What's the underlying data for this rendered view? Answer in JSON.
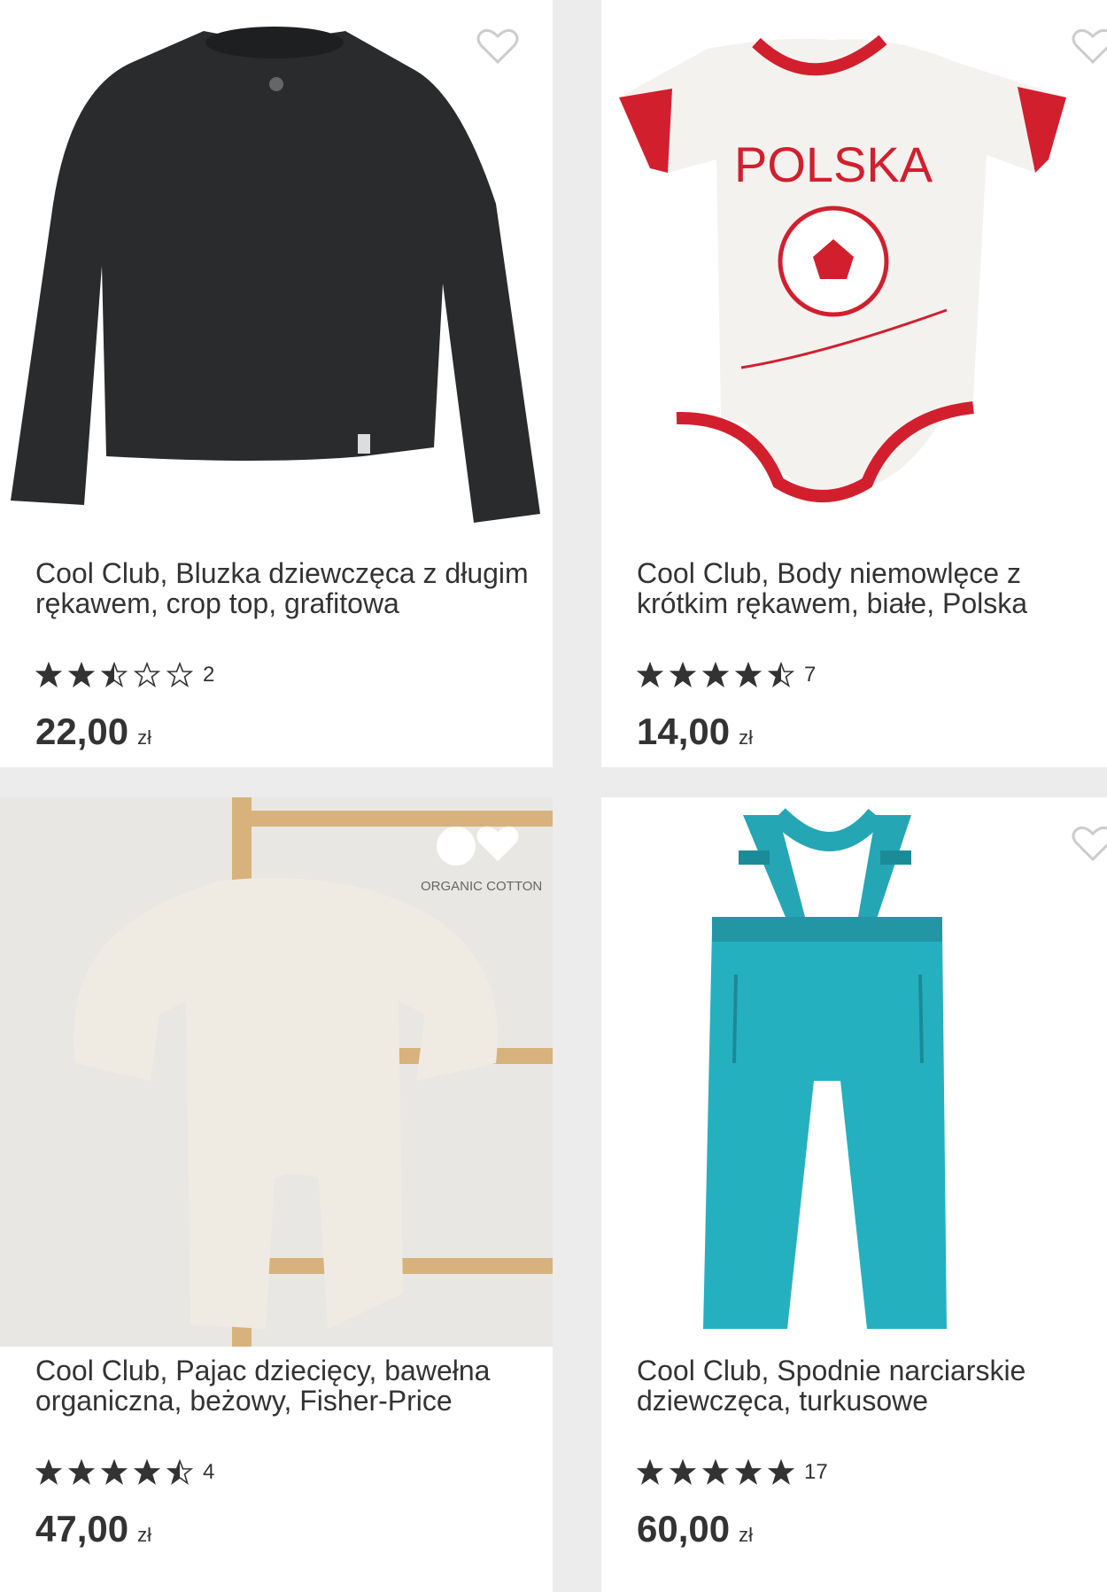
{
  "products": [
    {
      "title": "Cool Club, Bluzka dziewczęca z długim rękawem, crop top, grafitowa",
      "rating": 2.5,
      "review_count": "2",
      "price": "22,00",
      "currency": "zł"
    },
    {
      "title": "Cool Club, Body niemowlęce z krótkim rękawem, białe, Polska",
      "rating": 4.5,
      "review_count": "7",
      "price": "14,00",
      "currency": "zł",
      "image_text": "POLSKA"
    },
    {
      "title": "Cool Club, Pajac dziecięcy, bawełna organiczna, beżowy, Fisher-Price",
      "rating": 4.5,
      "review_count": "4",
      "price": "47,00",
      "currency": "zł",
      "badge": "ORGANIC COTTON"
    },
    {
      "title": "Cool Club, Spodnie narciarskie dziewczęca, turkusowe",
      "rating": 5,
      "review_count": "17",
      "price": "60,00",
      "currency": "zł"
    }
  ],
  "colors": {
    "text": "#333333",
    "star": "#333333",
    "heart": "#cccccc"
  },
  "icons": [
    "heart-outline-icon",
    "star-icon"
  ]
}
